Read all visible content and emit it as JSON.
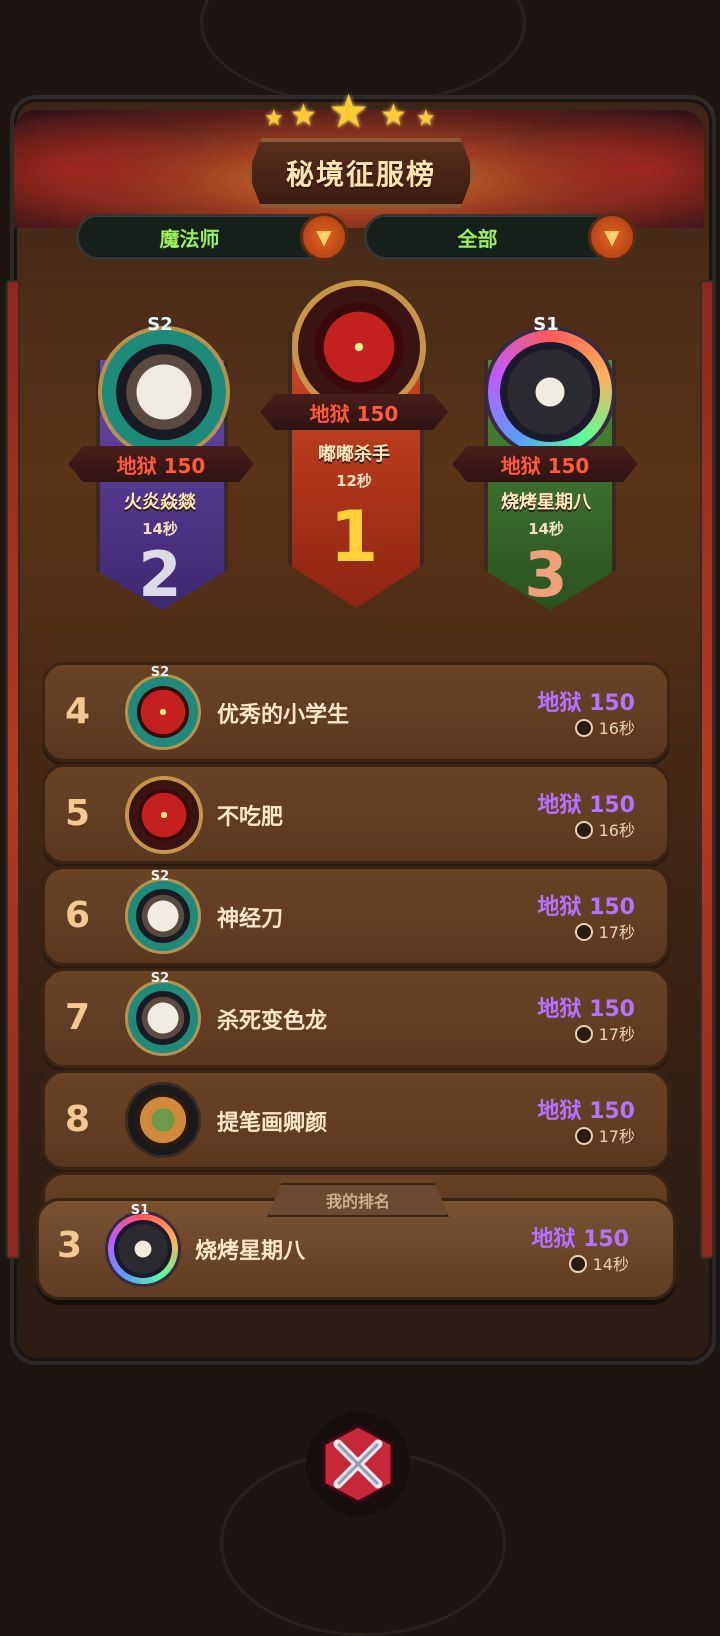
{
  "title": "秘境征服榜",
  "filters": {
    "class_label": "魔法师",
    "scope_label": "全部"
  },
  "podium": [
    {
      "rank": "2",
      "season": "S2",
      "difficulty": "地狱 150",
      "name": "火炎焱燚",
      "time": "14秒",
      "theme_color": "#5b3a8e"
    },
    {
      "rank": "1",
      "season": "",
      "difficulty": "地狱 150",
      "name": "嘟嘟杀手",
      "time": "12秒",
      "theme_color": "#b03a1e"
    },
    {
      "rank": "3",
      "season": "S1",
      "difficulty": "地狱 150",
      "name": "烧烤星期八",
      "time": "14秒",
      "theme_color": "#3e6a2e"
    }
  ],
  "list": [
    {
      "rank": "4",
      "season": "S2",
      "name": "优秀的小学生",
      "difficulty": "地狱 150",
      "time": "16秒",
      "avatar": "red-demon-avatar"
    },
    {
      "rank": "5",
      "season": "",
      "name": "不吃肥",
      "difficulty": "地狱 150",
      "time": "16秒",
      "avatar": "red-demon-avatar"
    },
    {
      "rank": "6",
      "season": "S2",
      "name": "神经刀",
      "difficulty": "地狱 150",
      "time": "17秒",
      "avatar": "goat-avatar"
    },
    {
      "rank": "7",
      "season": "S2",
      "name": "杀死变色龙",
      "difficulty": "地狱 150",
      "time": "17秒",
      "avatar": "goat-avatar"
    },
    {
      "rank": "8",
      "season": "",
      "name": "提笔画卿颜",
      "difficulty": "地狱 150",
      "time": "17秒",
      "avatar": "fox-avatar"
    }
  ],
  "my_rank": {
    "label": "我的排名",
    "rank": "3",
    "season": "S1",
    "name": "烧烤星期八",
    "difficulty": "地狱 150",
    "time": "14秒"
  },
  "close_icon": "close-icon",
  "colors": {
    "difficulty_purple": "#b870ff",
    "difficulty_red": "#ff5a3a",
    "filter_green": "#9cf05a",
    "accent_orange": "#e0641e"
  }
}
